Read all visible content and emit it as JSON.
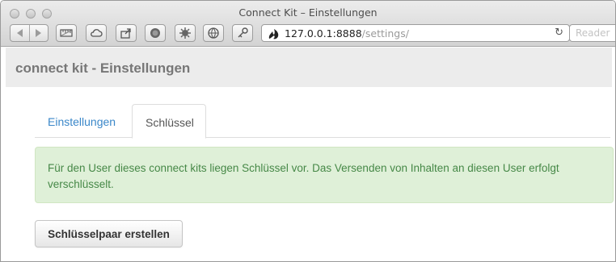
{
  "window": {
    "title": "Connect Kit – Einstellungen"
  },
  "toolbar": {
    "url_host": "127.0.0.1:8888",
    "url_path": "/settings/",
    "reload_icon": "↻",
    "reader_label": "Reader",
    "extension_icons": [
      "ruler-icon",
      "cloud-icon",
      "share-icon",
      "circle-icon",
      "gear-bug-icon",
      "globe-icon",
      "key-icon"
    ]
  },
  "header": {
    "brand": "connect kit - Einstellungen"
  },
  "tabs": [
    {
      "label": "Einstellungen",
      "active": false
    },
    {
      "label": "Schlüssel",
      "active": true
    }
  ],
  "alert": {
    "text": "Für den User dieses connect kits liegen Schlüssel vor. Das Versenden von Inhalten an diesen User erfolgt verschlüsselt."
  },
  "actions": {
    "create_keypair_label": "Schlüsselpaar erstellen"
  },
  "colors": {
    "link": "#3a87c9",
    "alert_bg": "#dff0d8",
    "alert_text": "#468847"
  }
}
